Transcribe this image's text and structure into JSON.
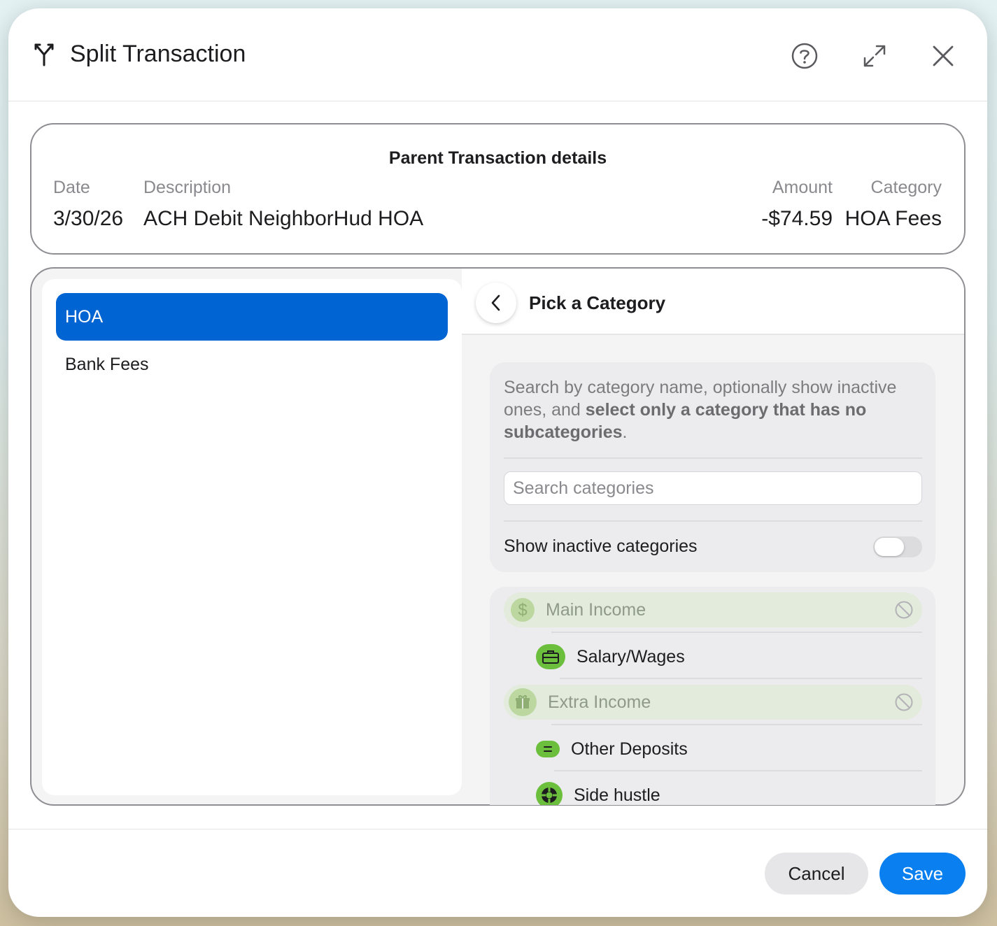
{
  "dialog": {
    "title": "Split Transaction",
    "icons": {
      "title": "split-icon",
      "help": "help-icon",
      "expand": "expand-icon",
      "close": "close-icon"
    }
  },
  "parent": {
    "heading": "Parent Transaction details",
    "labels": {
      "date": "Date",
      "description": "Description",
      "amount": "Amount",
      "category": "Category"
    },
    "values": {
      "date": "3/30/26",
      "description": "ACH Debit NeighborHud HOA",
      "amount": "-$74.59",
      "category": "HOA Fees"
    }
  },
  "splits": {
    "items": [
      {
        "label": "HOA",
        "selected": true
      },
      {
        "label": "Bank Fees",
        "selected": false
      }
    ]
  },
  "picker": {
    "title": "Pick a Category",
    "help_part1": "Search by category name, optionally show inactive ones, and ",
    "help_bold": "select only a category that has no subcategories",
    "help_end": ".",
    "search_placeholder": "Search categories",
    "search_value": "",
    "toggle_label": "Show inactive categories",
    "toggle_on": false,
    "categories": [
      {
        "label": "Main Income",
        "type": "parent",
        "icon": "dollar-icon",
        "selectable": false
      },
      {
        "label": "Salary/Wages",
        "type": "child",
        "icon": "briefcase-icon"
      },
      {
        "label": "Extra Income",
        "type": "parent",
        "icon": "gift-icon",
        "selectable": false
      },
      {
        "label": "Other Deposits",
        "type": "child",
        "icon": "equals-icon"
      },
      {
        "label": "Side hustle",
        "type": "child",
        "icon": "lifebuoy-icon"
      }
    ]
  },
  "footer": {
    "cancel": "Cancel",
    "save": "Save"
  },
  "colors": {
    "primary": "#0064d2",
    "save": "#0a7ff0",
    "category_green": "#6cbf3c",
    "parent_row": "#e3ebdc"
  }
}
